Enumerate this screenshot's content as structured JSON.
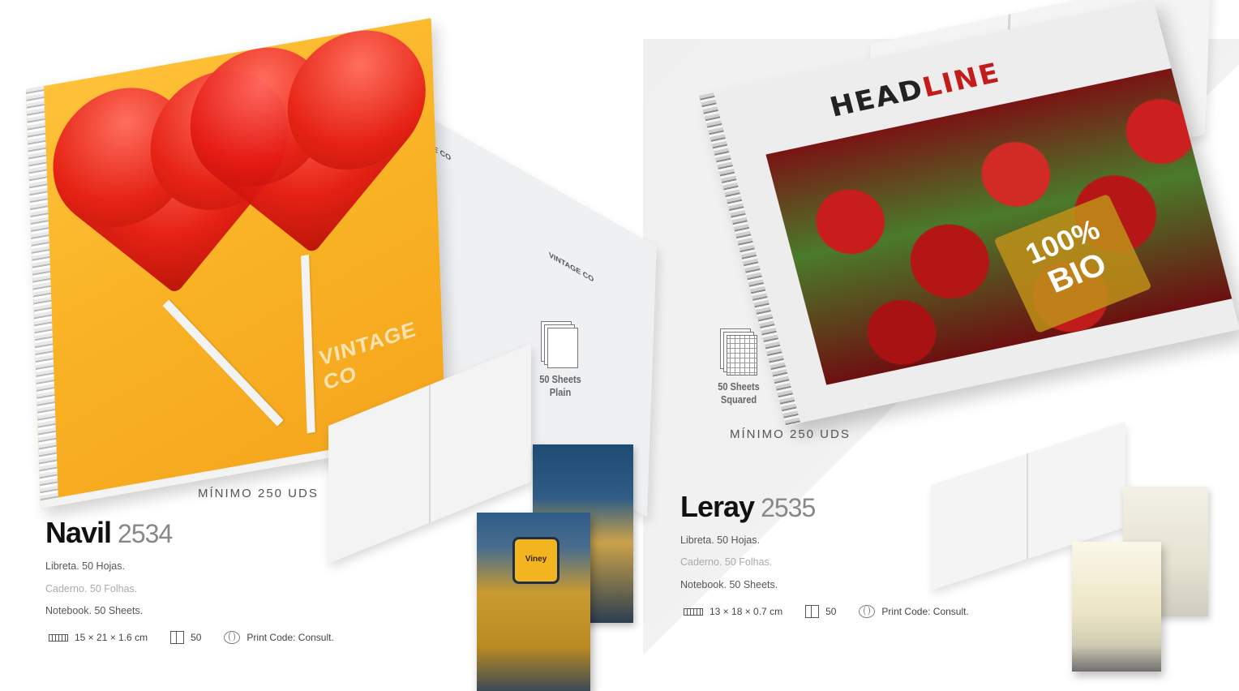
{
  "left_product": {
    "minimum": "MÍNIMO 250 UDS",
    "name": "Navil",
    "code": "2534",
    "lines": [
      "Libreta. 50 Hojas.",
      "Caderno. 50 Folhas.",
      "Notebook. 50 Sheets."
    ],
    "specs": {
      "size": "15 × 21 × 1.6 cm",
      "qty": "50",
      "print": "Print Code: Consult."
    },
    "sheets": {
      "line1": "50 Sheets",
      "line2": "Plain"
    },
    "cover_text": "VINTAGE CO",
    "inside_text_1": "VINTAGE CO",
    "inside_text_2": "VINTAGE CO",
    "badge_text": "Viney"
  },
  "right_product": {
    "minimum": "MÍNIMO 250 UDS",
    "name": "Leray",
    "code": "2535",
    "lines": [
      "Libreta. 50 Hojas.",
      "Caderno. 50 Folhas.",
      "Notebook. 50 Sheets."
    ],
    "specs": {
      "size": "13 × 18 × 0.7 cm",
      "qty": "50",
      "print": "Print Code: Consult."
    },
    "sheets": {
      "line1": "50 Sheets",
      "line2": "Squared"
    },
    "cover_headline_a": "HEAD",
    "cover_headline_b": "LINE",
    "bio_1": "100%",
    "bio_2": "BIO"
  },
  "icons": {
    "size": "ruler-icon",
    "qty": "box-icon",
    "print": "print-icon",
    "sheets_plain": "plain-sheets-icon",
    "sheets_squared": "squared-sheets-icon"
  }
}
